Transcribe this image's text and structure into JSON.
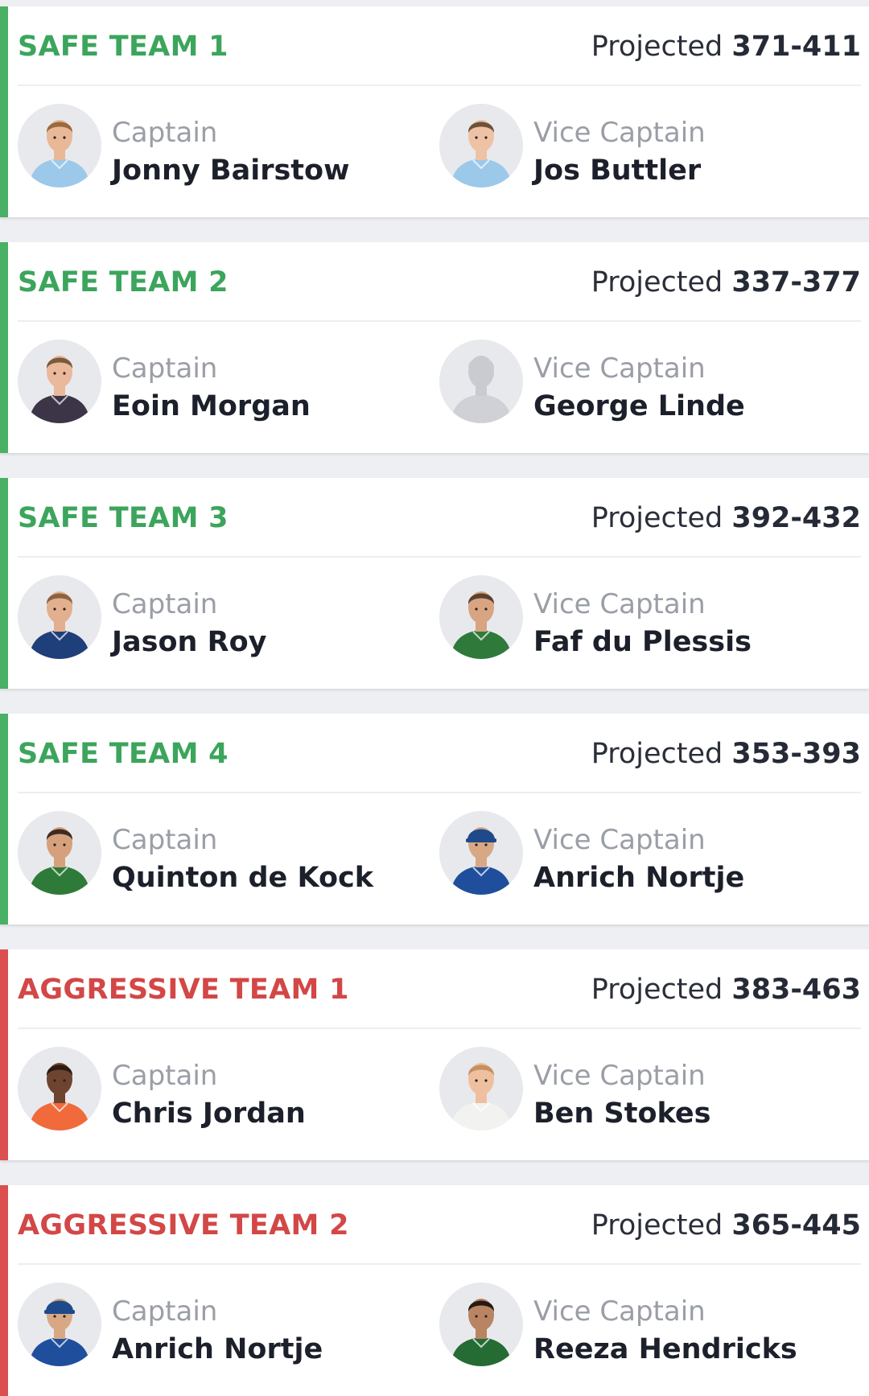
{
  "labels": {
    "projected": "Projected",
    "captain": "Captain",
    "vice_captain": "Vice Captain"
  },
  "colors": {
    "safe": "#3ca55c",
    "aggressive": "#d34747"
  },
  "teams": [
    {
      "title": "SAFE TEAM 1",
      "category": "safe",
      "projected_range": "371-411",
      "captain": {
        "name": "Jonny Bairstow",
        "jersey": "#9cc8ea",
        "skin": "#e8b898",
        "hair": "#9a6a3e",
        "cap": ""
      },
      "vice_captain": {
        "name": "Jos Buttler",
        "jersey": "#9cc8ea",
        "skin": "#eec2a4",
        "hair": "#6e5238",
        "cap": ""
      }
    },
    {
      "title": "SAFE TEAM 2",
      "category": "safe",
      "projected_range": "337-377",
      "captain": {
        "name": "Eoin Morgan",
        "jersey": "#3c3548",
        "skin": "#eab89a",
        "hair": "#7a5a3c",
        "cap": ""
      },
      "vice_captain": {
        "name": "George Linde",
        "jersey": "#cfd1d6",
        "skin": "#c9cbd0",
        "hair": "#c9cbd0",
        "cap": "",
        "placeholder": true
      }
    },
    {
      "title": "SAFE TEAM 3",
      "category": "safe",
      "projected_range": "392-432",
      "captain": {
        "name": "Jason Roy",
        "jersey": "#1e3f7a",
        "skin": "#e2b08e",
        "hair": "#8a6440",
        "cap": ""
      },
      "vice_captain": {
        "name": "Faf du Plessis",
        "jersey": "#2f7a3a",
        "skin": "#d8a482",
        "hair": "#5a4030",
        "cap": ""
      }
    },
    {
      "title": "SAFE TEAM 4",
      "category": "safe",
      "projected_range": "353-393",
      "captain": {
        "name": "Quinton de Kock",
        "jersey": "#2e7a38",
        "skin": "#d6a07c",
        "hair": "#3c2c22",
        "cap": ""
      },
      "vice_captain": {
        "name": "Anrich Nortje",
        "jersey": "#1f4f9c",
        "skin": "#d8a884",
        "hair": "#3c2c22",
        "cap": "#1e4a8c"
      }
    },
    {
      "title": "AGGRESSIVE TEAM 1",
      "category": "aggressive",
      "projected_range": "383-463",
      "captain": {
        "name": "Chris Jordan",
        "jersey": "#f06a3c",
        "skin": "#6e4430",
        "hair": "#2a1c14",
        "cap": ""
      },
      "vice_captain": {
        "name": "Ben Stokes",
        "jersey": "#f2f2f0",
        "skin": "#eec0a0",
        "hair": "#c49060",
        "cap": ""
      }
    },
    {
      "title": "AGGRESSIVE TEAM 2",
      "category": "aggressive",
      "projected_range": "365-445",
      "captain": {
        "name": "Anrich Nortje",
        "jersey": "#1f4f9c",
        "skin": "#d8a884",
        "hair": "#3c2c22",
        "cap": "#1e4a8c"
      },
      "vice_captain": {
        "name": "Reeza Hendricks",
        "jersey": "#256b34",
        "skin": "#b98462",
        "hair": "#241a14",
        "cap": ""
      }
    }
  ]
}
